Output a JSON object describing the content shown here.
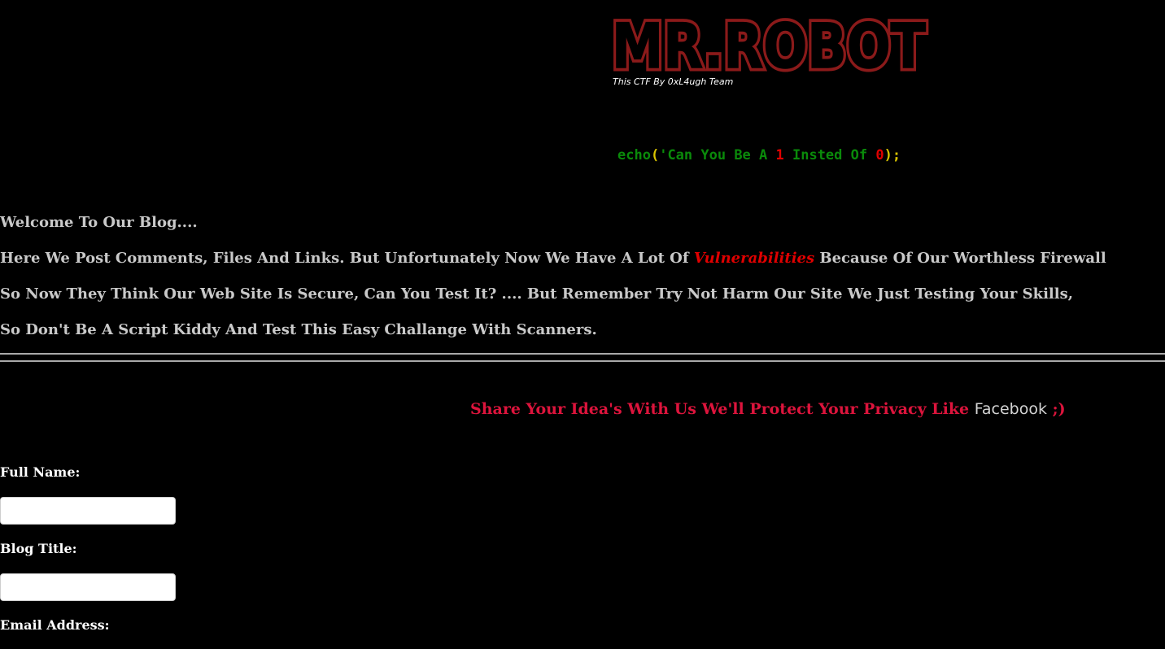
{
  "logo": {
    "title": "MR.ROBOT",
    "subtitle": "This CTF By 0xL4ugh Team",
    "color": "#8b1a1a"
  },
  "echo": {
    "fn": "echo",
    "open_paren": "(",
    "text_a": "'Can You Be A ",
    "one": "1",
    "text_b": " Insted Of ",
    "zero": "0",
    "close": ");"
  },
  "intro": {
    "welcome": "Welcome To Our Blog....",
    "line2_a": "Here We Post Comments, Files And Links. But Unfortunately Now We Have A Lot Of ",
    "line2_vuln": "Vulnerabilities",
    "line2_b": " Because Of Our Worthless Firewall",
    "line3": "So Now They Think Our Web Site Is Secure, Can You Test It? .... But Remember Try Not Harm Our Site We Just Testing Your Skills,",
    "line4": "So Don't Be A Script Kiddy And Test This Easy Challange With Scanners."
  },
  "share": {
    "text": "Share Your Idea's With Us We'll Protect Your Privacy Like ",
    "facebook": "Facebook",
    "wink": " ;)"
  },
  "form": {
    "full_name_label": "Full Name:",
    "full_name_value": "",
    "blog_title_label": "Blog Title:",
    "blog_title_value": "",
    "email_label": "Email Address:"
  },
  "colors": {
    "background": "#000000",
    "accent_red": "#dc143c",
    "echo_green": "#0a8a0a",
    "vuln_red": "#e00000"
  }
}
